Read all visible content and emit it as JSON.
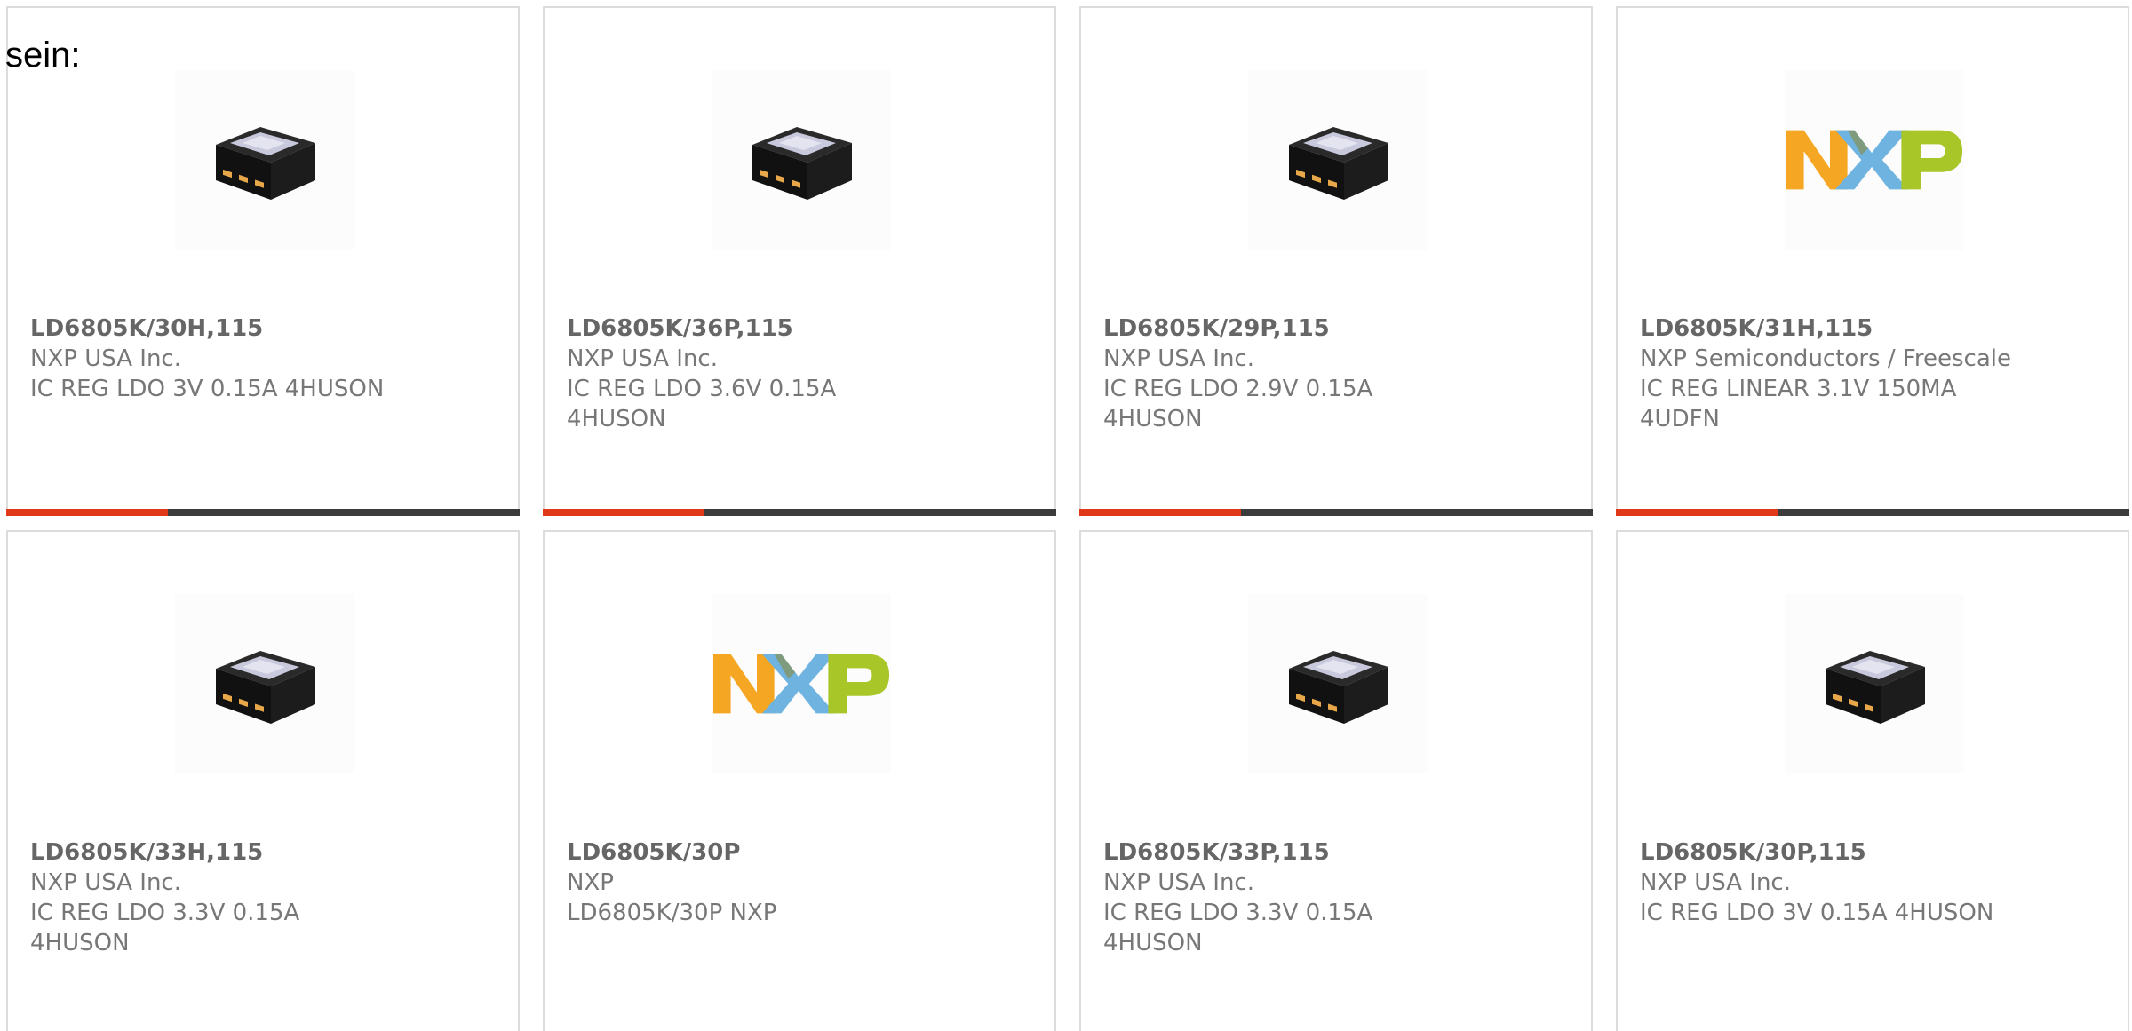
{
  "intro_text": "sein:",
  "colors": {
    "accent_bar": "#e0391a",
    "base_bar": "#3c3c3c",
    "text": "#777777",
    "nxp_n": "#f5a623",
    "nxp_x_blue": "#6fb3e0",
    "nxp_p": "#a8c628"
  },
  "products": [
    {
      "part_number": "LD6805K/30H,115",
      "manufacturer": "NXP USA Inc.",
      "description": "IC REG LDO 3V 0.15A 4HUSON",
      "image": "chip-package-icon"
    },
    {
      "part_number": "LD6805K/36P,115",
      "manufacturer": "NXP USA Inc.",
      "description": "IC REG LDO 3.6V 0.15A 4HUSON",
      "image": "chip-package-icon"
    },
    {
      "part_number": "LD6805K/29P,115",
      "manufacturer": "NXP USA Inc.",
      "description": "IC REG LDO 2.9V 0.15A 4HUSON",
      "image": "chip-package-icon"
    },
    {
      "part_number": "LD6805K/31H,115",
      "manufacturer": "NXP Semiconductors / Freescale",
      "description": "IC REG LINEAR 3.1V 150MA 4UDFN",
      "image": "nxp-logo"
    },
    {
      "part_number": "LD6805K/33H,115",
      "manufacturer": "NXP USA Inc.",
      "description": "IC REG LDO 3.3V 0.15A 4HUSON",
      "image": "chip-package-icon"
    },
    {
      "part_number": "LD6805K/30P",
      "manufacturer": "NXP",
      "description": "LD6805K/30P NXP",
      "image": "nxp-logo"
    },
    {
      "part_number": "LD6805K/33P,115",
      "manufacturer": "NXP USA Inc.",
      "description": "IC REG LDO 3.3V 0.15A 4HUSON",
      "image": "chip-package-icon"
    },
    {
      "part_number": "LD6805K/30P,115",
      "manufacturer": "NXP USA Inc.",
      "description": "IC REG LDO 3V 0.15A 4HUSON",
      "image": "chip-package-icon"
    }
  ]
}
